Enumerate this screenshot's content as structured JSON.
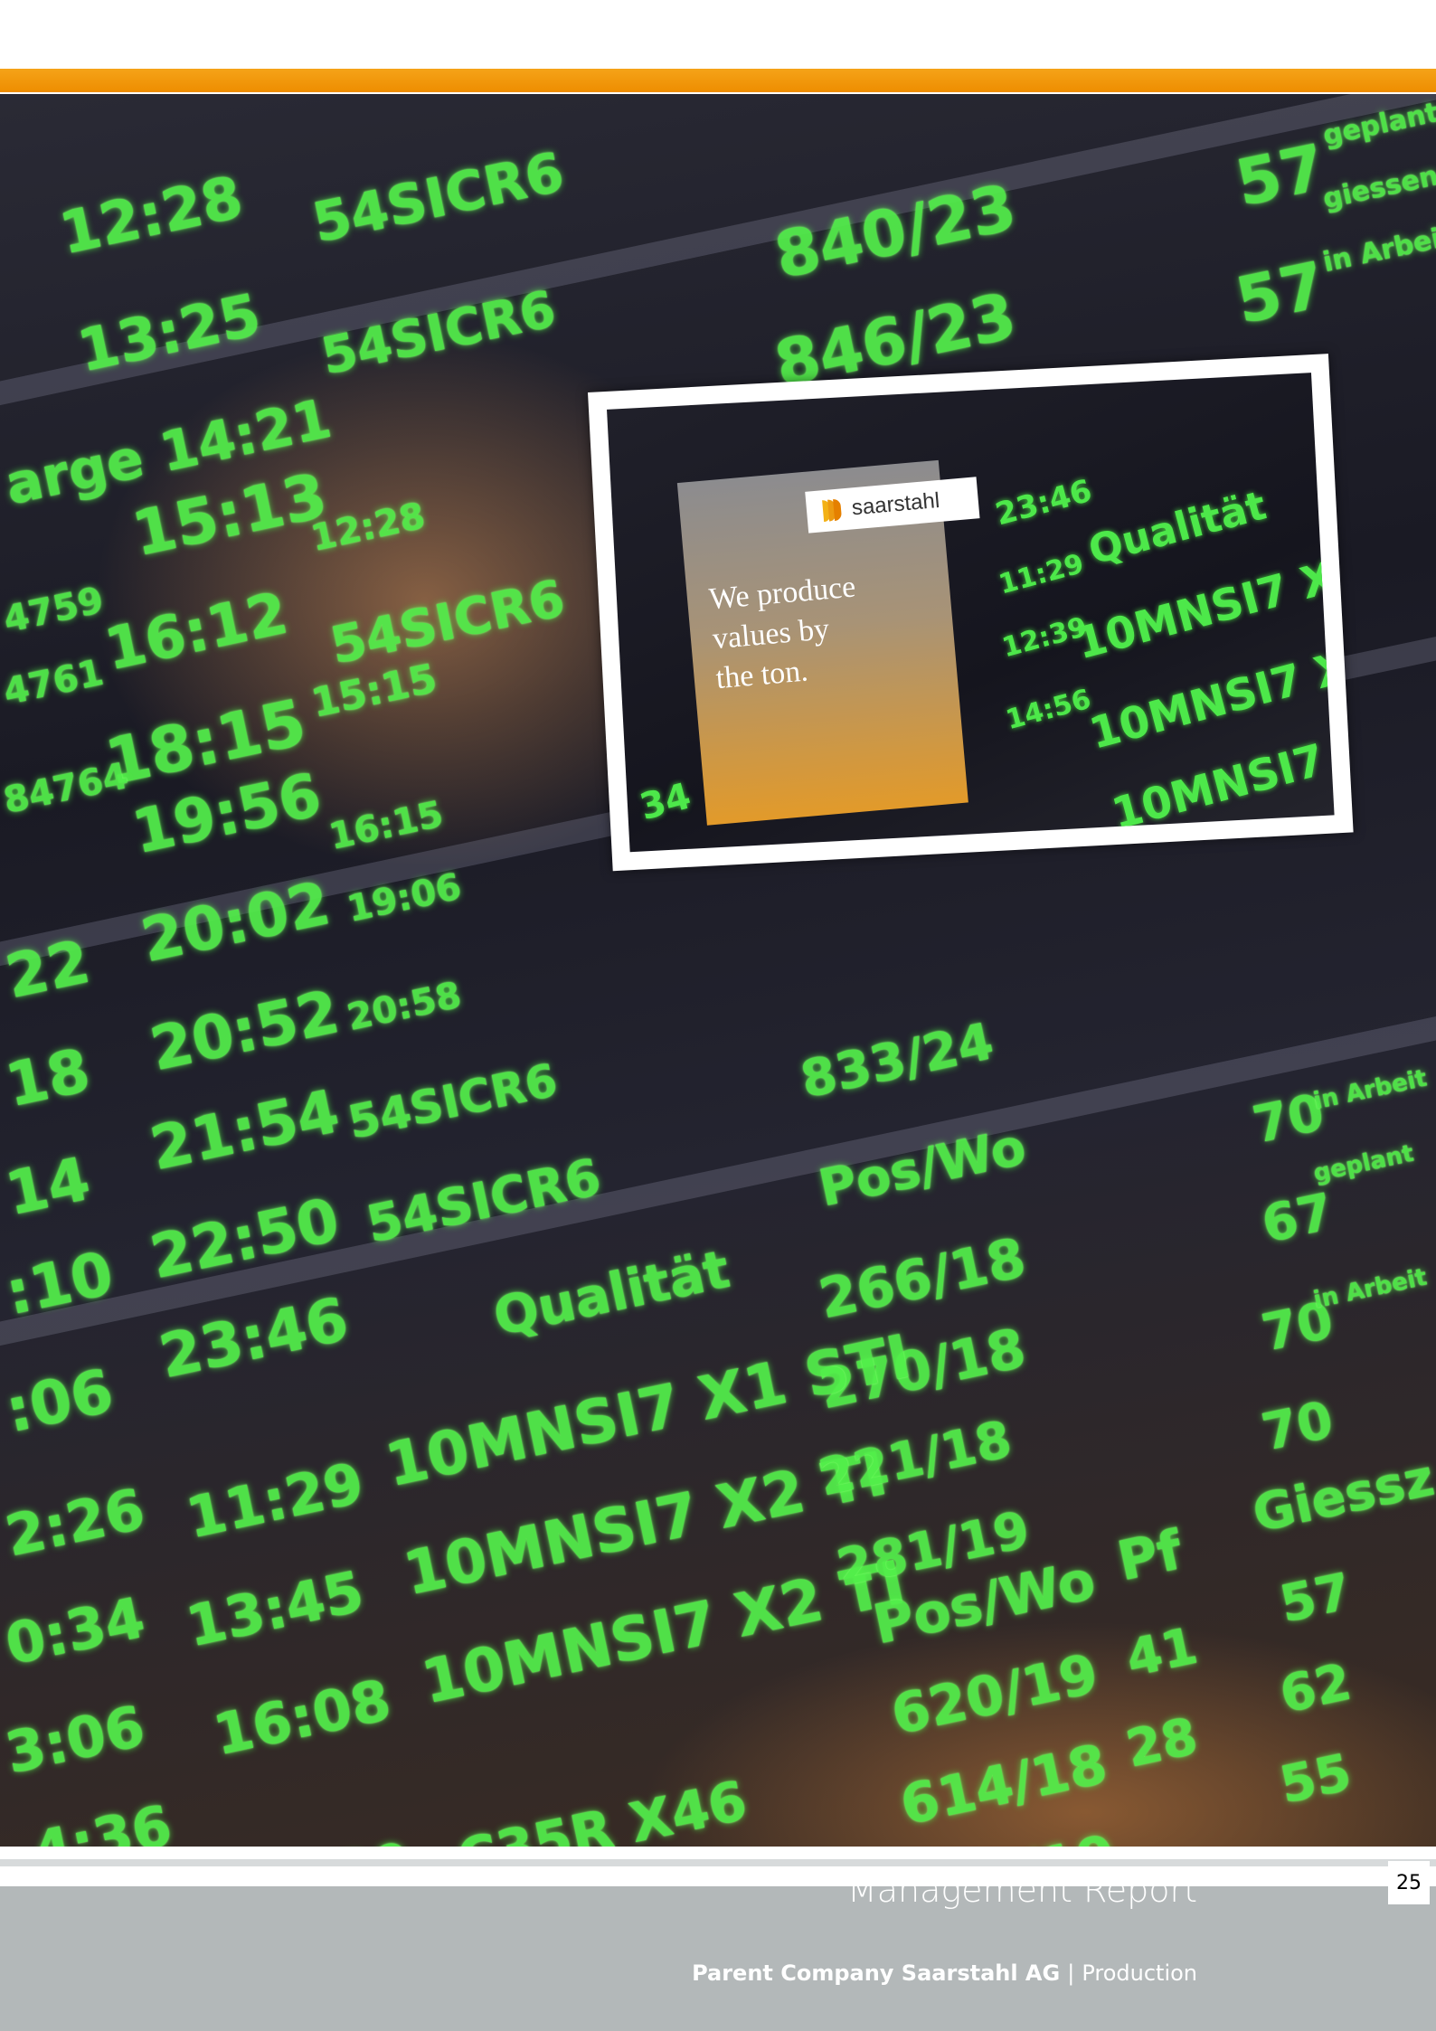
{
  "photo": {
    "description_icon": "trading-screen-photo",
    "poster": {
      "logo_text": "saarstahl",
      "slogan_line1": "We produce",
      "slogan_line2": "values by",
      "slogan_line3": "the ton."
    }
  },
  "footer": {
    "title": "Management Report",
    "company": "Parent Company Saarstahl AG",
    "separator": "|",
    "section": "Production",
    "page_number": "25"
  },
  "colors": {
    "orange": "#f39a12",
    "footer_gray": "#b3b8b9",
    "ticker_green": "#53f04b"
  }
}
